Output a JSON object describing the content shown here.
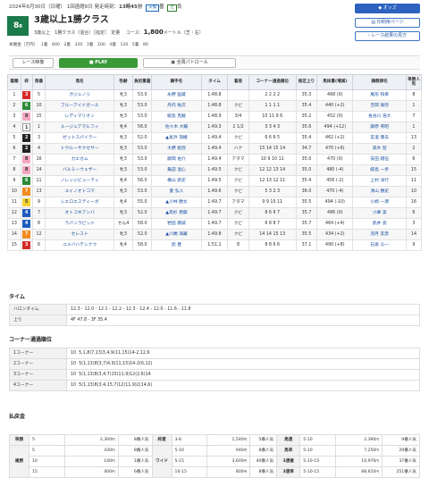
{
  "header": {
    "date": "2024年6月30日（日曜）",
    "meeting": "1回函館8日",
    "post_label": "発走時刻：",
    "post_time": "13時45分",
    "weather": "天候",
    "weather_val": "曇",
    "turf": "芝",
    "going": "良"
  },
  "race": {
    "num": "8",
    "unit": "R",
    "title": "3歳以上1勝クラス",
    "sub1": "3歳以上　1勝クラス（混合）［指定］　定量",
    "course_label": "コース：",
    "distance": "1,800",
    "course_rest": "メートル（芝・右）"
  },
  "prize": {
    "label": "本賞金（万円）",
    "values": [
      "1着　800",
      "2着　320",
      "3着　200",
      "4着　120",
      "5着　80"
    ]
  },
  "buttons": {
    "odds": "オッズ",
    "print": "印刷用ページ",
    "back": "レース結果の見方"
  },
  "media": {
    "video": "レース映像",
    "play": "PLAY",
    "patrol": "全周パトロール"
  },
  "table": {
    "headers": [
      "着順",
      "枠",
      "馬番",
      "馬名",
      "性齢",
      "負担重量",
      "騎手名",
      "タイム",
      "着差",
      "コーナー通過順位",
      "推定上り",
      "馬体重(増減)",
      "調教師名",
      "単勝人気"
    ],
    "rows": [
      [
        "1",
        "3",
        "5",
        "ガジュノリ",
        "牝3",
        "53.0",
        "永野 猛蔵",
        "1:48.8",
        "",
        "2 2 2 2",
        "35.3",
        "468 (0)",
        "尾形 和幸",
        "8"
      ],
      [
        "2",
        "6",
        "10",
        "ブルーアイドガール",
        "牝3",
        "53.0",
        "丹内 祐次",
        "1:48.8",
        "クビ",
        "1 1 1 1",
        "35.4",
        "440 (+2)",
        "吉岡 辰弥",
        "1"
      ],
      [
        "3",
        "8",
        "15",
        "レディマリオン",
        "牝3",
        "53.0",
        "鮫島 克駿",
        "1:48.9",
        "3/4",
        "10 11 9 6",
        "35.2",
        "452 (0)",
        "長谷川 浩大",
        "7"
      ],
      [
        "4",
        "1",
        "1",
        "ルージュアマルフィ",
        "牝4",
        "56.0",
        "佐々木 大輔",
        "1:49.3",
        "2 1/2",
        "3 3 4 3",
        "35.6",
        "494 (+12)",
        "藤原 英昭",
        "1"
      ],
      [
        "5",
        "2",
        "3",
        "ゼットスパイラー",
        "牝3",
        "52.0",
        "▲長浜 鴻緒",
        "1:49.4",
        "クビ",
        "6 6 6 5",
        "35.4",
        "462 (+2)",
        "友道 康夫",
        "13"
      ],
      [
        "6",
        "2",
        "4",
        "トウルーサクセサー",
        "牝3",
        "53.0",
        "大野 拓弥",
        "1:49.4",
        "ハナ",
        "15 14 15 14",
        "34.7",
        "470 (+6)",
        "高木 登",
        "2"
      ],
      [
        "7",
        "8",
        "16",
        "カエカム",
        "牝3",
        "53.0",
        "藤岡 佑介",
        "1:49.4",
        "アタマ",
        "10 9 10 11",
        "35.0",
        "470 (0)",
        "安田 翔伍",
        "6"
      ],
      [
        "8",
        "8",
        "14",
        "バルミーウェザー",
        "牝3",
        "53.0",
        "亀田 温心",
        "1:49.5",
        "クビ",
        "12 12 13 14",
        "35.0",
        "480 (-4)",
        "鮫島 一歩",
        "15"
      ],
      [
        "9",
        "6",
        "11",
        "ノレッジビューティ",
        "牝4",
        "56.0",
        "横山 武史",
        "1:49.5",
        "クビ",
        "12 13 12 11",
        "35.4",
        "456 (-2)",
        "上村 洋行",
        "11"
      ],
      [
        "10",
        "7",
        "13",
        "ユイノオトコマ",
        "牝3",
        "53.0",
        "菱 弘人",
        "1:49.6",
        "クビ",
        "5 3 2 3",
        "36.0",
        "470 (-4)",
        "清山 勝史",
        "10"
      ],
      [
        "11",
        "5",
        "9",
        "シエロエスティーボ",
        "牝4",
        "55.0",
        "▲小林 勝太",
        "1:49.7",
        "アタマ",
        "9 9 10 11",
        "35.5",
        "494 (-10)",
        "小崎 一源",
        "16"
      ],
      [
        "12",
        "4",
        "7",
        "オトコギアンバ",
        "牝3",
        "52.0",
        "▲高杉 吏麒",
        "1:49.7",
        "クビ",
        "8 6 6 7",
        "35.7",
        "486 (0)",
        "小栗 実",
        "6"
      ],
      [
        "13",
        "4",
        "8",
        "ラパンラピッド",
        "せん4",
        "58.0",
        "岩田 康誠",
        "1:49.7",
        "クビ",
        "6 8 8 7",
        "35.7",
        "464 (+4)",
        "武井 亮",
        "3"
      ],
      [
        "14",
        "7",
        "12",
        "セレスト",
        "牝3",
        "52.0",
        "▲川端 海翼",
        "1:49.8",
        "クビ",
        "14 14 15 13",
        "35.5",
        "434 (+2)",
        "羽月 友彦",
        "14"
      ],
      [
        "15",
        "3",
        "6",
        "ユメバハテシナク",
        "牝4",
        "58.0",
        "武 豊",
        "1:51.1",
        "8",
        "8 8 6 6",
        "37.1",
        "490 (+8)",
        "石坂 公一",
        "9"
      ]
    ]
  },
  "gate_colors": {
    "1": [
      "#ffffff",
      "#333333"
    ],
    "2": [
      "#222222",
      "#ffffff"
    ],
    "3": [
      "#d42a2a",
      "#ffffff"
    ],
    "4": [
      "#1f5bbd",
      "#ffffff"
    ],
    "5": [
      "#f2d230",
      "#333333"
    ],
    "6": [
      "#2c8a3a",
      "#ffffff"
    ],
    "7": [
      "#f08a1e",
      "#ffffff"
    ],
    "8": [
      "#f3a6c0",
      "#333333"
    ]
  },
  "time": {
    "title": "タイム",
    "lap_label": "ハロンタイム",
    "laps": "12.3 - 12.0 - 12.1 - 12.2 - 12.3 - 12.4 - 12.0 - 11.6 - 11.8",
    "last_label": "上り",
    "last": "4F 47.8 - 3F 35.4"
  },
  "corner": {
    "title": "コーナー通過順位",
    "rows": [
      {
        "label": "1コーナー",
        "start": "10",
        "val": "5,1,8(7,13)3,4,9(11,15)14-2,12,6"
      },
      {
        "label": "2コーナー",
        "start": "10",
        "val": "5(1,13)8(3,7)4,9(11,15)14-2(6,12)"
      },
      {
        "label": "3コーナー",
        "start": "10",
        "val": "5(1,13)8(3,4,7)15(11,9)12(2,6)14"
      },
      {
        "label": "4コーナー",
        "start": "10",
        "val": "5(1,13)8(3,4,15,7)12(11,9)2(14,6)"
      }
    ]
  },
  "payouts": {
    "title": "払戻金",
    "tansho": {
      "label": "単勝",
      "num": "5",
      "amt": "2,300",
      "unit": "円",
      "pop": "8番人気"
    },
    "fukusho": {
      "label": "複勝",
      "rows": [
        [
          "5",
          "430",
          "8番人気"
        ],
        [
          "10",
          "140",
          "1番人気"
        ],
        [
          "15",
          "400",
          "6番人気"
        ]
      ]
    },
    "wakuren": {
      "label": "枠連",
      "num": "3-6",
      "amt": "1,540",
      "pop": "5番人気"
    },
    "wide": {
      "label": "ワイド",
      "rows": [
        [
          "5-10",
          "940",
          "8番人気"
        ],
        [
          "5-15",
          "3,600",
          "40番人気"
        ],
        [
          "10-15",
          "800",
          "8番人気"
        ]
      ]
    },
    "umaren": {
      "label": "馬連",
      "num": "5-10",
      "amt": "2,390",
      "pop": "9番人気"
    },
    "umatan": {
      "label": "馬単",
      "num": "5-10",
      "amt": "7,250",
      "pop": "29番人気"
    },
    "trio": {
      "label": "3連複",
      "num": "5-10-15",
      "amt": "10,970",
      "pop": "37番人気"
    },
    "trifecta": {
      "label": "3連単",
      "num": "5-10-15",
      "amt": "88,610",
      "pop": "251番人気"
    }
  }
}
